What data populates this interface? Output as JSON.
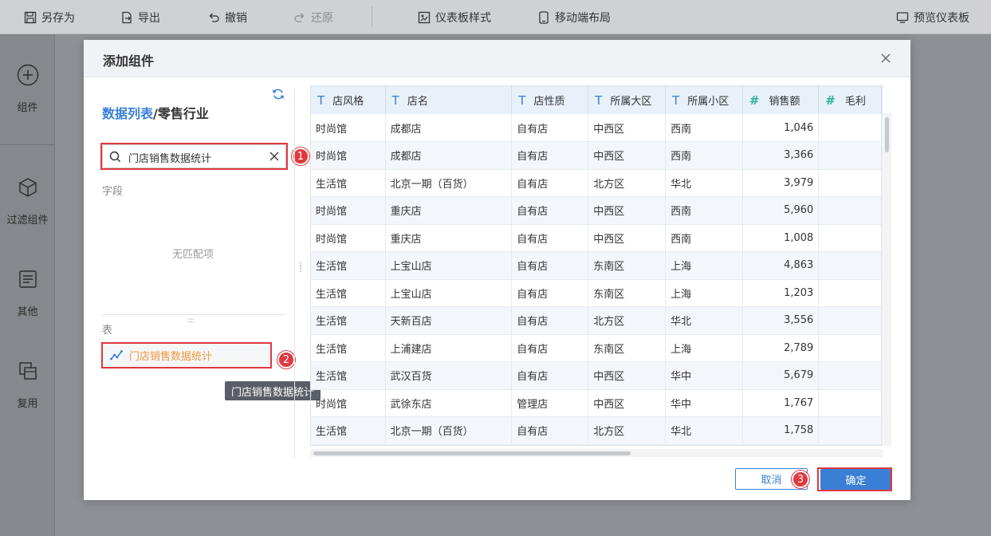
{
  "toolbar": {
    "save_as": "另存为",
    "export": "导出",
    "undo": "撤销",
    "redo": "还原",
    "dashboard_style": "仪表板样式",
    "mobile_layout": "移动端布局",
    "preview": "预览仪表板"
  },
  "rail": {
    "component": "组件",
    "filter_component": "过滤组件",
    "other": "其他",
    "reuse": "复用"
  },
  "dialog": {
    "title": "添加组件",
    "breadcrumb_link": "数据列表",
    "breadcrumb_rest": "/零售行业",
    "search_value": "门店销售数据统计",
    "fields_label": "字段",
    "no_match": "无匹配项",
    "tables_label": "表",
    "table_item": "门店销售数据统计",
    "tooltip": "门店销售数据统计",
    "cancel": "取消",
    "confirm": "确定",
    "badges": [
      "1",
      "2",
      "3"
    ]
  },
  "grid": {
    "columns": [
      {
        "label": "店风格",
        "type": "text"
      },
      {
        "label": "店名",
        "type": "text"
      },
      {
        "label": "店性质",
        "type": "text"
      },
      {
        "label": "所属大区",
        "type": "text"
      },
      {
        "label": "所属小区",
        "type": "text"
      },
      {
        "label": "销售额",
        "type": "number"
      },
      {
        "label": "毛利",
        "type": "number"
      }
    ],
    "rows": [
      [
        "时尚馆",
        "成都店",
        "自有店",
        "中西区",
        "西南",
        "1,046",
        ""
      ],
      [
        "时尚馆",
        "成都店",
        "自有店",
        "中西区",
        "西南",
        "3,366",
        ""
      ],
      [
        "生活馆",
        "北京一期（百货）",
        "自有店",
        "北方区",
        "华北",
        "3,979",
        ""
      ],
      [
        "时尚馆",
        "重庆店",
        "自有店",
        "中西区",
        "西南",
        "5,960",
        ""
      ],
      [
        "时尚馆",
        "重庆店",
        "自有店",
        "中西区",
        "西南",
        "1,008",
        ""
      ],
      [
        "生活馆",
        "上宝山店",
        "自有店",
        "东南区",
        "上海",
        "4,863",
        ""
      ],
      [
        "生活馆",
        "上宝山店",
        "自有店",
        "东南区",
        "上海",
        "1,203",
        ""
      ],
      [
        "生活馆",
        "天新百店",
        "自有店",
        "北方区",
        "华北",
        "3,556",
        ""
      ],
      [
        "生活馆",
        "上浦建店",
        "自有店",
        "东南区",
        "上海",
        "2,789",
        ""
      ],
      [
        "生活馆",
        "武汉百货",
        "自有店",
        "中西区",
        "华中",
        "5,679",
        ""
      ],
      [
        "时尚馆",
        "武徐东店",
        "管理店",
        "中西区",
        "华中",
        "1,767",
        ""
      ],
      [
        "生活馆",
        "北京一期（百货）",
        "自有店",
        "北方区",
        "华北",
        "1,758",
        ""
      ]
    ]
  },
  "colors": {
    "accent": "#3a7fd6",
    "highlight": "#e0383e",
    "table_item": "#f0993b",
    "number_icon": "#2eb39a"
  }
}
